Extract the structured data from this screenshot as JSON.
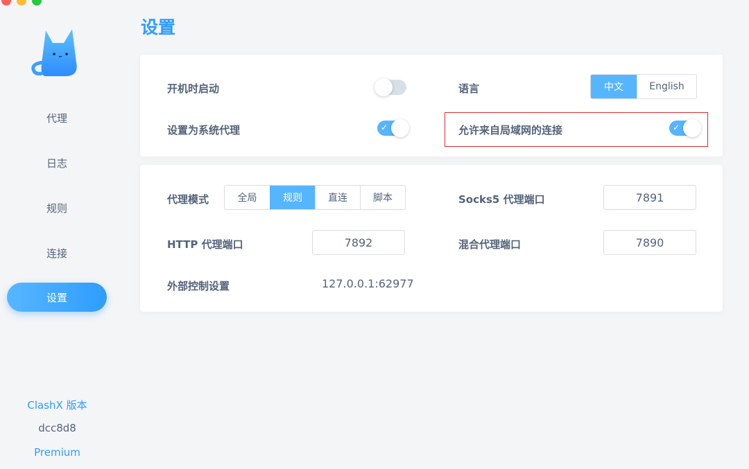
{
  "window": {
    "title": "设置"
  },
  "colors": {
    "accent": "#2e9dff",
    "toggle_on": "#56b5ff",
    "highlight": "#e0282e"
  },
  "sidebar": {
    "items": [
      {
        "label": "代理"
      },
      {
        "label": "日志"
      },
      {
        "label": "规则"
      },
      {
        "label": "连接"
      },
      {
        "label": "设置",
        "active": true
      }
    ],
    "version_label": "ClashX 版本",
    "version": "dcc8d8",
    "edition": "Premium"
  },
  "general": {
    "launch_at_login": {
      "label": "开机时启动",
      "on": false
    },
    "system_proxy": {
      "label": "设置为系统代理",
      "on": true
    },
    "language": {
      "label": "语言",
      "options": [
        "中文",
        "English"
      ],
      "selected": "中文"
    },
    "allow_lan": {
      "label": "允许来自局域网的连接",
      "on": true
    }
  },
  "proxy": {
    "mode": {
      "label": "代理模式",
      "options": [
        "全局",
        "规则",
        "直连",
        "脚本"
      ],
      "selected": "规则"
    },
    "http_port": {
      "label": "HTTP 代理端口",
      "value": "7892"
    },
    "socks_port": {
      "label": "Socks5 代理端口",
      "value": "7891"
    },
    "mixed_port": {
      "label": "混合代理端口",
      "value": "7890"
    },
    "external_controller": {
      "label": "外部控制设置",
      "value": "127.0.0.1:62977"
    }
  }
}
